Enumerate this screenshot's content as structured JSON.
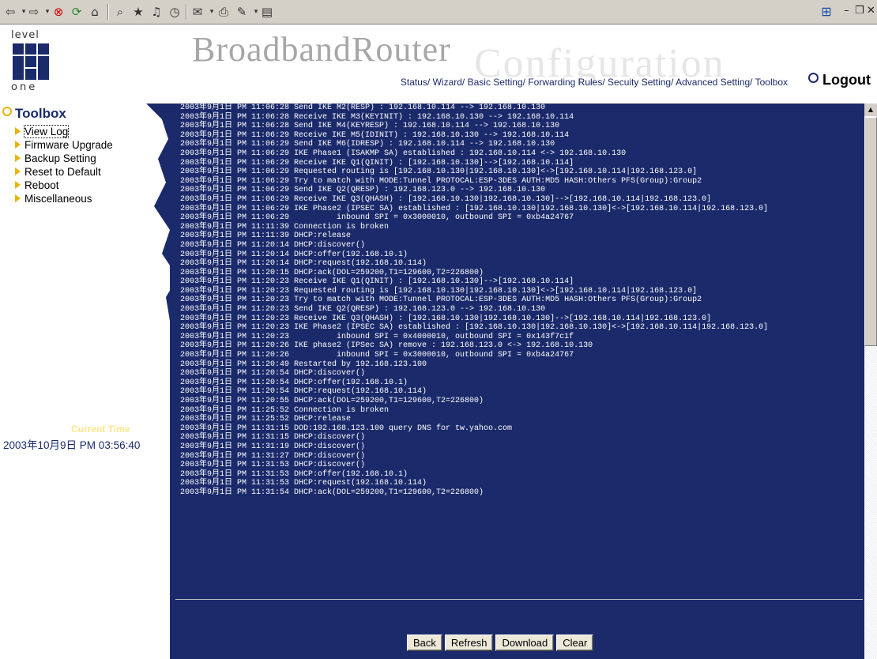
{
  "toolbar": {
    "icons": [
      "back-icon",
      "forward-icon",
      "stop-icon",
      "refresh-icon",
      "home-icon",
      "search-icon",
      "favorites-icon",
      "media-icon",
      "history-icon",
      "mail-icon",
      "print-icon",
      "edit-icon",
      "discuss-icon"
    ]
  },
  "header": {
    "logo_top": "level",
    "logo_bottom": "one",
    "brand": "BroadbandRouter",
    "brand_ghost": "Configuration",
    "nav": [
      "Status/",
      "Wizard/",
      "Basic Setting/",
      "Forwarding Rules/",
      "Secuity Setting/",
      "Advanced Setting/",
      "Toolbox"
    ],
    "logout": "Logout"
  },
  "sidebar": {
    "title": "Toolbox",
    "items": [
      "View Log",
      "Firmware Upgrade",
      "Backup Setting",
      "Reset to Default",
      "Reboot",
      "Miscellaneous"
    ],
    "current_time_label": "Current Time",
    "current_time_value": "2003年10月9日 PM 03:56:40"
  },
  "log": [
    "2003年9月1日 PM 11:06:28 Send IKE M2(RESP) : 192.168.10.114 --> 192.168.10.130",
    "2003年9月1日 PM 11:06:28 Receive IKE M3(KEYINIT) : 192.168.10.130 --> 192.168.10.114",
    "2003年9月1日 PM 11:06:28 Send IKE M4(KEYRESP) : 192.168.10.114 --> 192.168.10.130",
    "2003年9月1日 PM 11:06:29 Receive IKE M5(IDINIT) : 192.168.10.130 --> 192.168.10.114",
    "2003年9月1日 PM 11:06:29 Send IKE M6(IDRESP) : 192.168.10.114 --> 192.168.10.130",
    "2003年9月1日 PM 11:06:29 IKE Phase1 (ISAKMP SA) established : 192.168.10.114 <-> 192.168.10.130",
    "2003年9月1日 PM 11:06:29 Receive IKE Q1(QINIT) : [192.168.10.130]-->[192.168.10.114]",
    "2003年9月1日 PM 11:06:29 Requested routing is [192.168.10.130|192.168.10.130]<->[192.168.10.114|192.168.123.0]",
    "2003年9月1日 PM 11:06:29 Try to match with MODE:Tunnel PROTOCAL:ESP-3DES AUTH:MD5 HASH:Others PFS(Group):Group2",
    "2003年9月1日 PM 11:06:29 Send IKE Q2(QRESP) : 192.168.123.0 --> 192.168.10.130",
    "2003年9月1日 PM 11:06:29 Receive IKE Q3(QHASH) : [192.168.10.130|192.168.10.130]-->[192.168.10.114|192.168.123.0]",
    "2003年9月1日 PM 11:06:29 IKE Phase2 (IPSEC SA) established : [192.168.10.130|192.168.10.130]<->[192.168.10.114|192.168.123.0]",
    "2003年9月1日 PM 11:06:29          inbound SPI = 0x3000010, outbound SPI = 0xb4a24767",
    "2003年9月1日 PM 11:11:39 Connection is broken",
    "2003年9月1日 PM 11:11:39 DHCP:release",
    "2003年9月1日 PM 11:20:14 DHCP:discover()",
    "2003年9月1日 PM 11:20:14 DHCP:offer(192.168.10.1)",
    "2003年9月1日 PM 11:20:14 DHCP:request(192.168.10.114)",
    "2003年9月1日 PM 11:20:15 DHCP:ack(DOL=259200,T1=129600,T2=226800)",
    "2003年9月1日 PM 11:20:23 Receive IKE Q1(QINIT) : [192.168.10.130]-->[192.168.10.114]",
    "2003年9月1日 PM 11:20:23 Requested routing is [192.168.10.130|192.168.10.130]<->[192.168.10.114|192.168.123.0]",
    "2003年9月1日 PM 11:20:23 Try to match with MODE:Tunnel PROTOCAL:ESP-3DES AUTH:MD5 HASH:Others PFS(Group):Group2",
    "2003年9月1日 PM 11:20:23 Send IKE Q2(QRESP) : 192.168.123.0 --> 192.168.10.130",
    "2003年9月1日 PM 11:20:23 Receive IKE Q3(QHASH) : [192.168.10.130|192.168.10.130]-->[192.168.10.114|192.168.123.0]",
    "2003年9月1日 PM 11:20:23 IKE Phase2 (IPSEC SA) established : [192.168.10.130|192.168.10.130]<->[192.168.10.114|192.168.123.0]",
    "2003年9月1日 PM 11:20:23          inbound SPI = 0x4000010, outbound SPI = 0x143f7c1f",
    "2003年9月1日 PM 11:20:26 IKE phase2 (IPSec SA) remove : 192.168.123.0 <-> 192.168.10.130",
    "2003年9月1日 PM 11:20:26          inbound SPI = 0x3000010, outbound SPI = 0xb4a24767",
    "2003年9月1日 PM 11:20:49 Restarted by 192.168.123.100",
    "2003年9月1日 PM 11:20:54 DHCP:discover()",
    "2003年9月1日 PM 11:20:54 DHCP:offer(192.168.10.1)",
    "2003年9月1日 PM 11:20:54 DHCP:request(192.168.10.114)",
    "2003年9月1日 PM 11:20:55 DHCP:ack(DOL=259200,T1=129600,T2=226800)",
    "2003年9月1日 PM 11:25:52 Connection is broken",
    "2003年9月1日 PM 11:25:52 DHCP:release",
    "2003年9月1日 PM 11:31:15 DOD:192.168.123.100 query DNS for tw.yahoo.com",
    "2003年9月1日 PM 11:31:15 DHCP:discover()",
    "2003年9月1日 PM 11:31:19 DHCP:discover()",
    "2003年9月1日 PM 11:31:27 DHCP:discover()",
    "2003年9月1日 PM 11:31:53 DHCP:discover()",
    "2003年9月1日 PM 11:31:53 DHCP:offer(192.168.10.1)",
    "2003年9月1日 PM 11:31:53 DHCP:request(192.168.10.114)",
    "2003年9月1日 PM 11:31:54 DHCP:ack(DOL=259200,T1=129600,T2=226800)"
  ],
  "buttons": {
    "back": "Back",
    "refresh": "Refresh",
    "download": "Download",
    "clear": "Clear"
  },
  "colors": {
    "navy": "#1b2a6b",
    "accent": "#e8b400"
  }
}
